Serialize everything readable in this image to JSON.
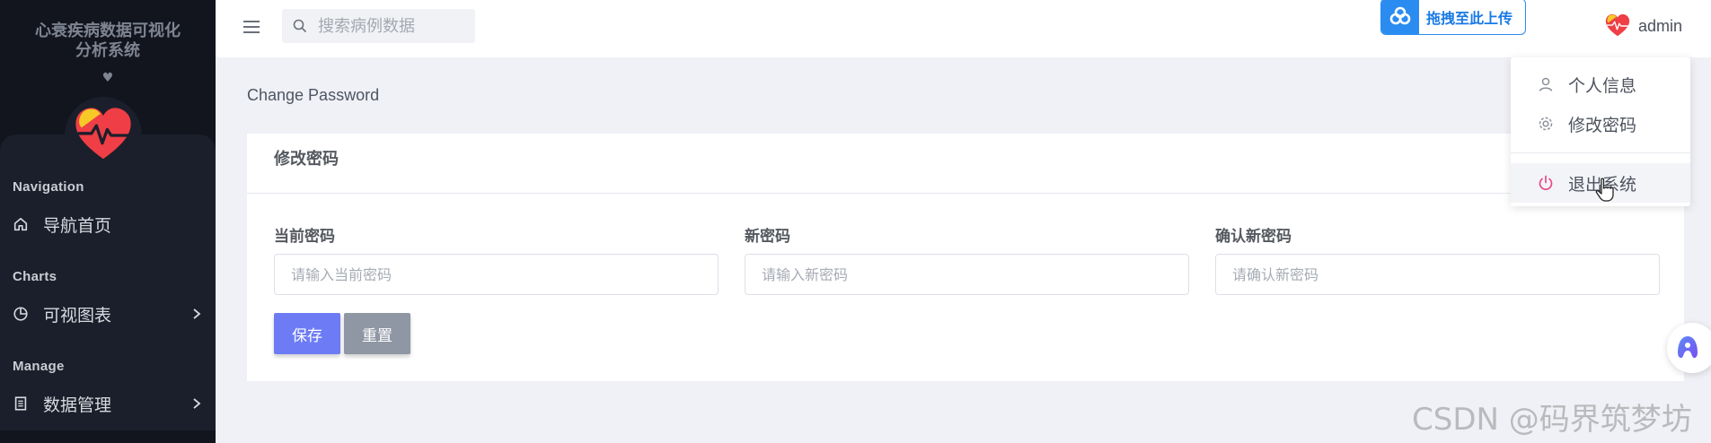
{
  "sidebar": {
    "brand_line1": "心衰疾病数据可视化",
    "brand_line2": "分析系统",
    "brand_heart": "♥",
    "sections": [
      {
        "title": "Navigation",
        "item": {
          "label": "导航首页",
          "icon": "home-icon"
        }
      },
      {
        "title": "Charts",
        "item": {
          "label": "可视图表",
          "icon": "pie-chart-icon"
        }
      },
      {
        "title": "Manage",
        "item": {
          "label": "数据管理",
          "icon": "document-icon"
        }
      }
    ]
  },
  "header": {
    "search_placeholder": "搜索病例数据",
    "upload_label": "拖拽至此上传",
    "user_name": "admin"
  },
  "main": {
    "breadcrumb": "Change Password",
    "card_title": "修改密码",
    "fields": [
      {
        "label": "当前密码",
        "placeholder": "请输入当前密码",
        "value": ""
      },
      {
        "label": "新密码",
        "placeholder": "请输入新密码",
        "value": ""
      },
      {
        "label": "确认新密码",
        "placeholder": "请确认新密码",
        "value": ""
      }
    ],
    "save_label": "保存",
    "reset_label": "重置"
  },
  "user_menu": {
    "items": [
      {
        "label": "个人信息",
        "icon": "user-icon"
      },
      {
        "label": "修改密码",
        "icon": "gear-icon"
      },
      {
        "label": "退出系统",
        "icon": "power-icon"
      }
    ]
  },
  "watermark": "CSDN @码界筑梦坊",
  "colors": {
    "sidebar_bg": "#12151e",
    "accent": "#6d7cf5",
    "upload_blue": "#2a8cf0",
    "logout_pink": "#e8488a"
  }
}
